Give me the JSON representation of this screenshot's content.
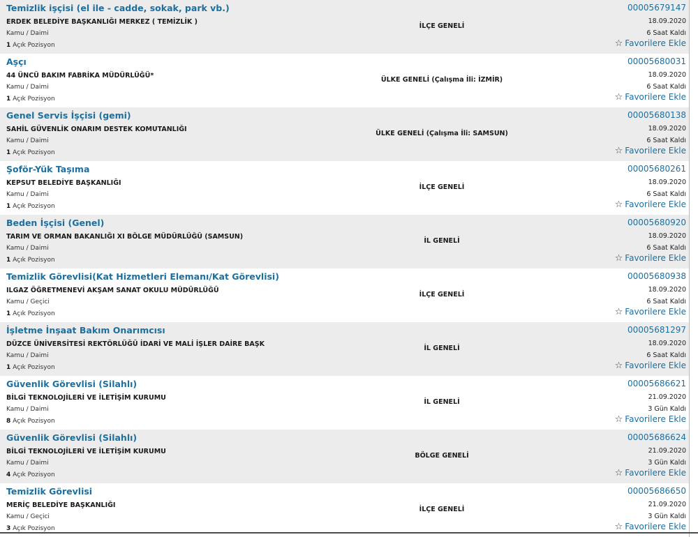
{
  "listings": [
    {
      "title": "Temizlik işçisi (el ile - cadde, sokak, park vb.)",
      "org": "ERDEK BELEDİYE BAŞKANLIĞI MERKEZ ( TEMİZLİK )",
      "type": "Kamu / Daimi",
      "count": "1",
      "positions_label": "Açık Pozisyon",
      "scope": "İLÇE GENELİ",
      "ref": "00005679147",
      "date": "18.09.2020",
      "remaining": "6 Saat Kaldı",
      "fav_label": "Favorilere Ekle"
    },
    {
      "title": "Aşçı",
      "org": "44 ÜNCÜ BAKIM FABRİKA MÜDÜRLÜĞÜ*",
      "type": "Kamu / Daimi",
      "count": "1",
      "positions_label": "Açık Pozisyon",
      "scope": "ÜLKE GENELİ (Çalışma İli: İZMİR)",
      "ref": "00005680031",
      "date": "18.09.2020",
      "remaining": "6 Saat Kaldı",
      "fav_label": "Favorilere Ekle"
    },
    {
      "title": "Genel Servis İşçisi (gemi)",
      "org": "SAHİL GÜVENLİK ONARIM DESTEK KOMUTANLIĞI",
      "type": "Kamu / Daimi",
      "count": "1",
      "positions_label": "Açık Pozisyon",
      "scope": "ÜLKE GENELİ (Çalışma İli: SAMSUN)",
      "ref": "00005680138",
      "date": "18.09.2020",
      "remaining": "6 Saat Kaldı",
      "fav_label": "Favorilere Ekle"
    },
    {
      "title": "Şoför-Yük Taşıma",
      "org": "KEPSUT BELEDİYE BAŞKANLIĞI",
      "type": "Kamu / Daimi",
      "count": "1",
      "positions_label": "Açık Pozisyon",
      "scope": "İLÇE GENELİ",
      "ref": "00005680261",
      "date": "18.09.2020",
      "remaining": "6 Saat Kaldı",
      "fav_label": "Favorilere Ekle"
    },
    {
      "title": "Beden İşçisi (Genel)",
      "org": "TARIM VE ORMAN BAKANLIĞI XI BÖLGE MÜDÜRLÜĞÜ (SAMSUN)",
      "type": "Kamu / Daimi",
      "count": "1",
      "positions_label": "Açık Pozisyon",
      "scope": "İL GENELİ",
      "ref": "00005680920",
      "date": "18.09.2020",
      "remaining": "6 Saat Kaldı",
      "fav_label": "Favorilere Ekle"
    },
    {
      "title": "Temizlik Görevlisi(Kat Hizmetleri Elemanı/Kat Görevlisi)",
      "org": "ILGAZ ÖĞRETMENEVİ AKŞAM SANAT OKULU MÜDÜRLÜĞÜ",
      "type": "Kamu / Geçici",
      "count": "1",
      "positions_label": "Açık Pozisyon",
      "scope": "İLÇE GENELİ",
      "ref": "00005680938",
      "date": "18.09.2020",
      "remaining": "6 Saat Kaldı",
      "fav_label": "Favorilere Ekle"
    },
    {
      "title": "İşletme İnşaat Bakım Onarımcısı",
      "org": "DÜZCE ÜNİVERSİTESİ REKTÖRLÜĞÜ İDARİ VE MALİ İŞLER DAİRE BAŞK",
      "type": "Kamu / Daimi",
      "count": "1",
      "positions_label": "Açık Pozisyon",
      "scope": "İL GENELİ",
      "ref": "00005681297",
      "date": "18.09.2020",
      "remaining": "6 Saat Kaldı",
      "fav_label": "Favorilere Ekle"
    },
    {
      "title": "Güvenlik Görevlisi (Silahlı)",
      "org": "BİLGİ TEKNOLOJİLERİ VE İLETİŞİM KURUMU",
      "type": "Kamu / Daimi",
      "count": "8",
      "positions_label": "Açık Pozisyon",
      "scope": "İL GENELİ",
      "ref": "00005686621",
      "date": "21.09.2020",
      "remaining": "3 Gün Kaldı",
      "fav_label": "Favorilere Ekle"
    },
    {
      "title": "Güvenlik Görevlisi (Silahlı)",
      "org": "BİLGİ TEKNOLOJİLERİ VE İLETİŞİM KURUMU",
      "type": "Kamu / Daimi",
      "count": "4",
      "positions_label": "Açık Pozisyon",
      "scope": "BÖLGE GENELİ",
      "ref": "00005686624",
      "date": "21.09.2020",
      "remaining": "3 Gün Kaldı",
      "fav_label": "Favorilere Ekle"
    },
    {
      "title": "Temizlik Görevlisi",
      "org": "MERİÇ BELEDİYE BAŞKANLIĞI",
      "type": "Kamu / Geçici",
      "count": "3",
      "positions_label": "Açık Pozisyon",
      "scope": "İLÇE GENELİ",
      "ref": "00005686650",
      "date": "21.09.2020",
      "remaining": "3 Gün Kaldı",
      "fav_label": "Favorilere Ekle"
    }
  ],
  "icons": {
    "favorite": "star-outline-icon"
  },
  "colors": {
    "link": "#1d6f9e",
    "row_alt": "#ececec",
    "row_plain": "#ffffff"
  }
}
